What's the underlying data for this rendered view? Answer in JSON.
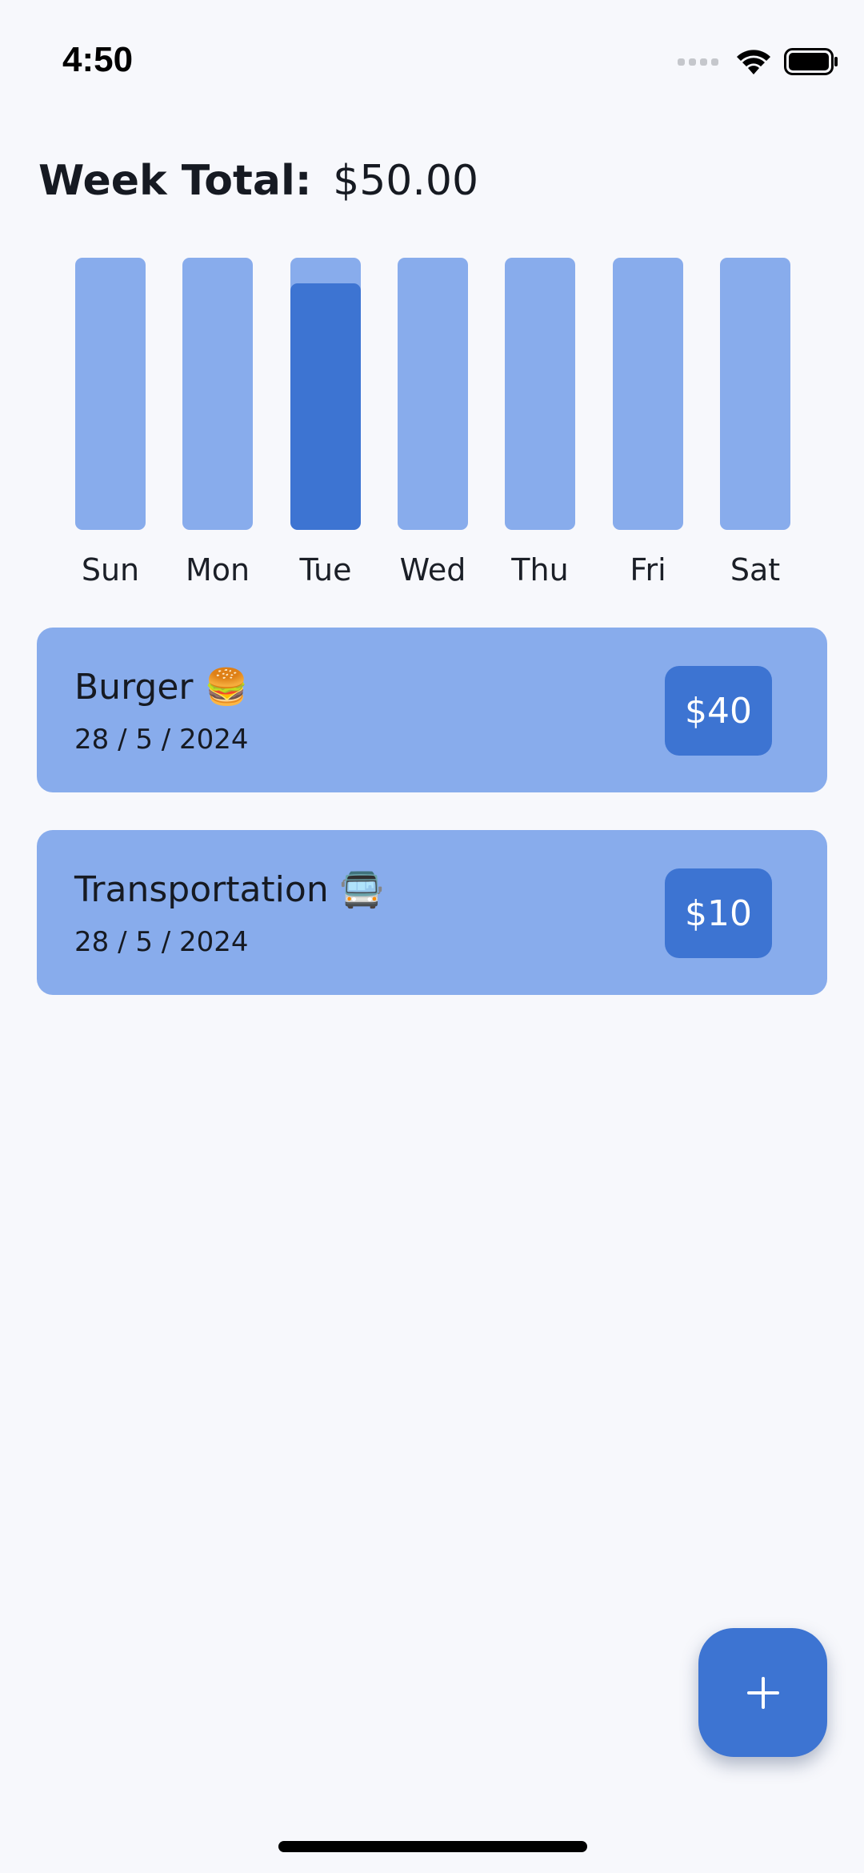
{
  "status_bar": {
    "time": "4:50",
    "icons": [
      "signal-icon",
      "wifi-icon",
      "battery-icon"
    ]
  },
  "header": {
    "label": "Week Total:",
    "value": "$50.00"
  },
  "chart_data": {
    "type": "bar",
    "categories": [
      "Sun",
      "Mon",
      "Tue",
      "Wed",
      "Thu",
      "Fri",
      "Sat"
    ],
    "values": [
      0,
      0,
      50,
      0,
      0,
      0,
      0
    ],
    "ylim": [
      0,
      50
    ],
    "highlight": [
      "Tue"
    ]
  },
  "expenses": [
    {
      "title": "Burger 🍔",
      "date": "28 / 5 / 2024",
      "amount": "$40"
    },
    {
      "title": "Transportation 🚍",
      "date": "28 / 5 / 2024",
      "amount": "$10"
    }
  ],
  "fab": {
    "icon": "plus-icon"
  },
  "colors": {
    "background": "#f7f8fc",
    "card": "#88acec",
    "accent": "#3d74d2",
    "text": "#161a22"
  }
}
